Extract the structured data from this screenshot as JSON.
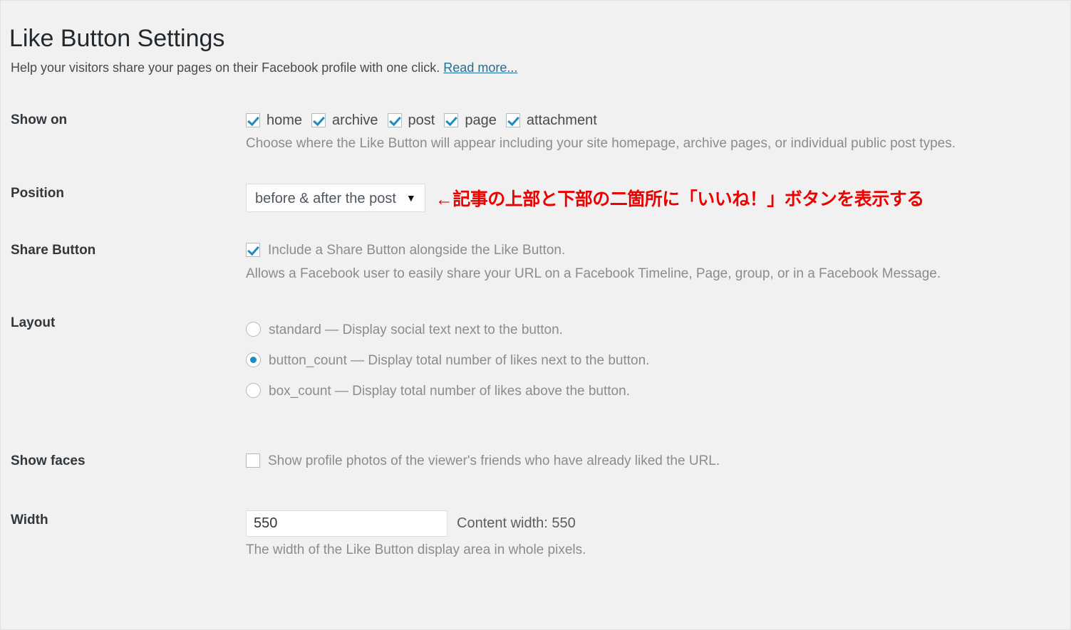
{
  "header": {
    "title": "Like Button Settings",
    "intro_text": "Help your visitors share your pages on their Facebook profile with one click. ",
    "read_more_label": "Read more..."
  },
  "colors": {
    "accent_blue": "#1e8cbe",
    "link_blue": "#1e6f9b",
    "annotation_red": "#ec0000",
    "page_bg": "#f1f1f1",
    "label_text": "#32373c",
    "desc_text": "#8c8c8c"
  },
  "rows": {
    "show_on": {
      "label": "Show on",
      "options": [
        {
          "label": "home",
          "checked": true
        },
        {
          "label": "archive",
          "checked": true
        },
        {
          "label": "post",
          "checked": true
        },
        {
          "label": "page",
          "checked": true
        },
        {
          "label": "attachment",
          "checked": true
        }
      ],
      "description": "Choose where the Like Button will appear including your site homepage, archive pages, or individual public post types."
    },
    "position": {
      "label": "Position",
      "selected_value": "before & after the post",
      "caret": "▼",
      "annotation": "←記事の上部と下部の二箇所に「いいね！」ボタンを表示する"
    },
    "share_button": {
      "label": "Share Button",
      "checkbox_label": "Include a Share Button alongside the Like Button.",
      "checked": true,
      "description": "Allows a Facebook user to easily share your URL on a Facebook Timeline, Page, group, or in a Facebook Message."
    },
    "layout": {
      "label": "Layout",
      "options": [
        {
          "label": "standard — Display social text next to the button.",
          "selected": false
        },
        {
          "label": "button_count — Display total number of likes next to the button.",
          "selected": true
        },
        {
          "label": "box_count — Display total number of likes above the button.",
          "selected": false
        }
      ]
    },
    "show_faces": {
      "label": "Show faces",
      "checkbox_label": "Show profile photos of the viewer's friends who have already liked the URL.",
      "checked": false
    },
    "width": {
      "label": "Width",
      "value": "550",
      "content_width_text": "Content width: 550",
      "description": "The width of the Like Button display area in whole pixels."
    }
  }
}
